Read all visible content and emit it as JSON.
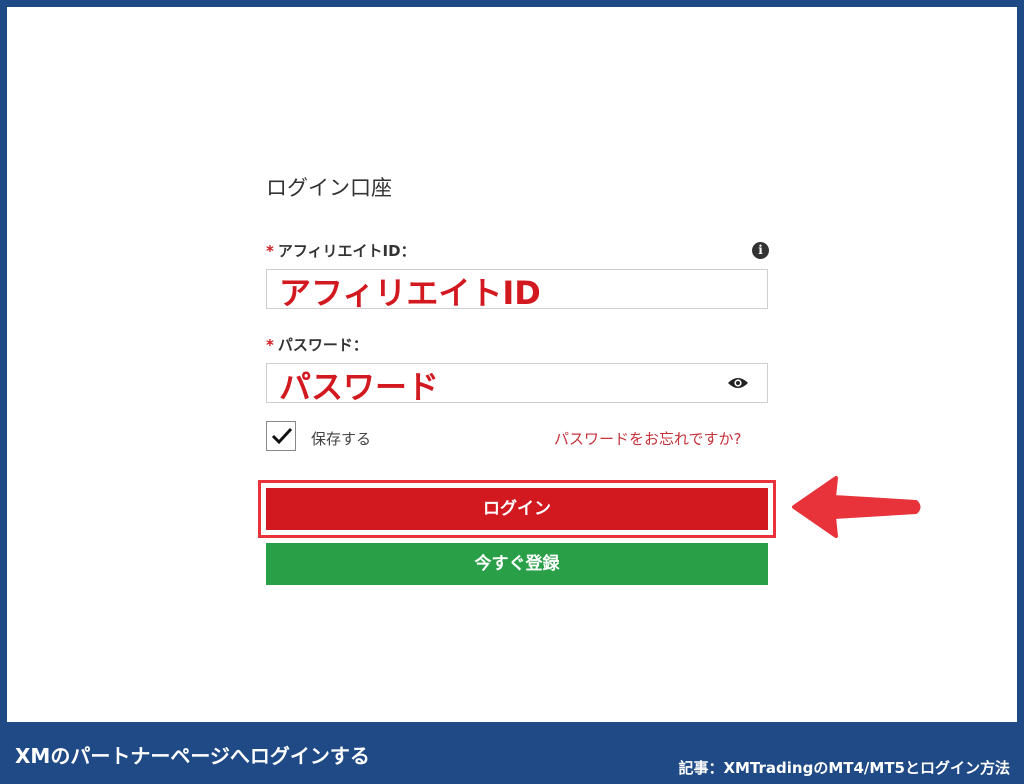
{
  "form": {
    "title": "ログイン口座",
    "affiliate": {
      "required_mark": "*",
      "label": "アフィリエイトID：",
      "value": "アフィリエイトID"
    },
    "password": {
      "required_mark": "*",
      "label": "パスワード：",
      "value": "パスワード"
    },
    "remember_label": "保存する",
    "remember_checked": true,
    "forgot_link": "パスワードをお忘れですか?",
    "login_button": "ログイン",
    "register_button": "今すぐ登録",
    "info_icon_glyph": "i"
  },
  "colors": {
    "frame": "#1f4a86",
    "accent_red": "#d31920",
    "register_green": "#29a047",
    "annotation_red": "#e8333b"
  },
  "captions": {
    "left": "XMのパートナーページへログインする",
    "right": "記事：XMTradingのMT4/MT5とログイン方法"
  },
  "icons": {
    "info": "info-icon",
    "eye": "eye-icon",
    "check": "check-icon",
    "arrow": "arrow-left-icon"
  }
}
